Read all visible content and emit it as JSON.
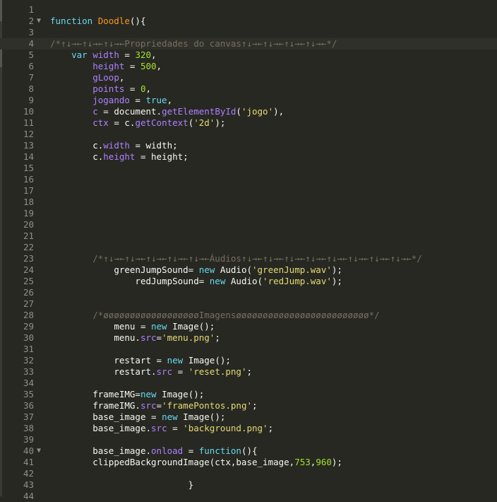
{
  "editor": {
    "lines": [
      {
        "n": "1",
        "fold": "",
        "indent": "",
        "tokens": []
      },
      {
        "n": "2",
        "fold": "▼",
        "indent": "",
        "tokens": [
          {
            "t": "kw",
            "v": "function "
          },
          {
            "t": "fn",
            "v": "Doodle"
          },
          {
            "t": "plain",
            "v": "(){"
          }
        ]
      },
      {
        "n": "3",
        "fold": "",
        "indent": "",
        "tokens": []
      },
      {
        "n": "4",
        "fold": "",
        "indent": "",
        "tokens": [
          {
            "t": "cmt",
            "v": "/*↑↓→←↑↓→←↑↓→←Propriedades do canvas↑↓→←↑↓→←↑↓→←↑↓→←*/"
          }
        ]
      },
      {
        "n": "5",
        "fold": "",
        "indent": "    ",
        "tokens": [
          {
            "t": "kw",
            "v": "var "
          },
          {
            "t": "var",
            "v": "width"
          },
          {
            "t": "plain",
            "v": " = "
          },
          {
            "t": "num",
            "v": "320"
          },
          {
            "t": "plain",
            "v": ","
          }
        ]
      },
      {
        "n": "6",
        "fold": "",
        "indent": "        ",
        "tokens": [
          {
            "t": "var",
            "v": "height"
          },
          {
            "t": "plain",
            "v": " = "
          },
          {
            "t": "num",
            "v": "500"
          },
          {
            "t": "plain",
            "v": ","
          }
        ]
      },
      {
        "n": "7",
        "fold": "",
        "indent": "        ",
        "tokens": [
          {
            "t": "var",
            "v": "gLoop"
          },
          {
            "t": "plain",
            "v": ","
          }
        ]
      },
      {
        "n": "8",
        "fold": "",
        "indent": "        ",
        "tokens": [
          {
            "t": "var",
            "v": "points"
          },
          {
            "t": "plain",
            "v": " = "
          },
          {
            "t": "num",
            "v": "0"
          },
          {
            "t": "plain",
            "v": ","
          }
        ]
      },
      {
        "n": "9",
        "fold": "",
        "indent": "        ",
        "tokens": [
          {
            "t": "var",
            "v": "jogando"
          },
          {
            "t": "plain",
            "v": " = "
          },
          {
            "t": "kw",
            "v": "true"
          },
          {
            "t": "plain",
            "v": ","
          }
        ]
      },
      {
        "n": "10",
        "fold": "",
        "indent": "        ",
        "tokens": [
          {
            "t": "var",
            "v": "c"
          },
          {
            "t": "plain",
            "v": " = document."
          },
          {
            "t": "var",
            "v": "getElementById"
          },
          {
            "t": "plain",
            "v": "("
          },
          {
            "t": "str",
            "v": "'jogo'"
          },
          {
            "t": "plain",
            "v": "),"
          }
        ]
      },
      {
        "n": "11",
        "fold": "",
        "indent": "        ",
        "tokens": [
          {
            "t": "var",
            "v": "ctx"
          },
          {
            "t": "plain",
            "v": " = c."
          },
          {
            "t": "var",
            "v": "getContext"
          },
          {
            "t": "plain",
            "v": "("
          },
          {
            "t": "str",
            "v": "'2d'"
          },
          {
            "t": "plain",
            "v": ");"
          }
        ]
      },
      {
        "n": "12",
        "fold": "",
        "indent": "",
        "tokens": []
      },
      {
        "n": "13",
        "fold": "",
        "indent": "        ",
        "tokens": [
          {
            "t": "plain",
            "v": "c."
          },
          {
            "t": "var",
            "v": "width"
          },
          {
            "t": "plain",
            "v": " = width;"
          }
        ]
      },
      {
        "n": "14",
        "fold": "",
        "indent": "        ",
        "tokens": [
          {
            "t": "plain",
            "v": "c."
          },
          {
            "t": "var",
            "v": "height"
          },
          {
            "t": "plain",
            "v": " = height;"
          }
        ]
      },
      {
        "n": "15",
        "fold": "",
        "indent": "",
        "tokens": []
      },
      {
        "n": "16",
        "fold": "",
        "indent": "",
        "tokens": []
      },
      {
        "n": "17",
        "fold": "",
        "indent": "",
        "tokens": []
      },
      {
        "n": "18",
        "fold": "",
        "indent": "",
        "tokens": []
      },
      {
        "n": "19",
        "fold": "",
        "indent": "",
        "tokens": []
      },
      {
        "n": "20",
        "fold": "",
        "indent": "",
        "tokens": []
      },
      {
        "n": "21",
        "fold": "",
        "indent": "",
        "tokens": []
      },
      {
        "n": "22",
        "fold": "",
        "indent": "",
        "tokens": []
      },
      {
        "n": "23",
        "fold": "",
        "indent": "        ",
        "tokens": [
          {
            "t": "cmt",
            "v": "/*↑↓→←↑↓→←↑↓→←↑↓→←↑↓→←Áudios↑↓→←↑↓→←↑↓→←↑↓→←↑↓→←↑↓→←↑↓→←↑↓→←*/"
          }
        ]
      },
      {
        "n": "24",
        "fold": "",
        "indent": "            ",
        "tokens": [
          {
            "t": "plain",
            "v": "greenJumpSound= "
          },
          {
            "t": "kw",
            "v": "new "
          },
          {
            "t": "plain",
            "v": "Audio("
          },
          {
            "t": "str",
            "v": "'greenJump.wav'"
          },
          {
            "t": "plain",
            "v": ");"
          }
        ]
      },
      {
        "n": "25",
        "fold": "",
        "indent": "                ",
        "tokens": [
          {
            "t": "plain",
            "v": "redJumpSound= "
          },
          {
            "t": "kw",
            "v": "new "
          },
          {
            "t": "plain",
            "v": "Audio("
          },
          {
            "t": "str",
            "v": "'redJump.wav'"
          },
          {
            "t": "plain",
            "v": ");"
          }
        ]
      },
      {
        "n": "26",
        "fold": "",
        "indent": "",
        "tokens": []
      },
      {
        "n": "27",
        "fold": "",
        "indent": "",
        "tokens": []
      },
      {
        "n": "28",
        "fold": "",
        "indent": "        ",
        "tokens": [
          {
            "t": "cmt",
            "v": "/*øøøøøøøøøøøøøøøøøøImagensøøøøøøøøøøøøøøøøøøøøøøøøø*/"
          }
        ]
      },
      {
        "n": "29",
        "fold": "",
        "indent": "            ",
        "tokens": [
          {
            "t": "plain",
            "v": "menu = "
          },
          {
            "t": "kw",
            "v": "new "
          },
          {
            "t": "plain",
            "v": "Image();"
          }
        ]
      },
      {
        "n": "30",
        "fold": "",
        "indent": "            ",
        "tokens": [
          {
            "t": "plain",
            "v": "menu."
          },
          {
            "t": "var",
            "v": "src"
          },
          {
            "t": "plain",
            "v": "="
          },
          {
            "t": "str",
            "v": "'menu.png'"
          },
          {
            "t": "plain",
            "v": ";"
          }
        ]
      },
      {
        "n": "31",
        "fold": "",
        "indent": "",
        "tokens": []
      },
      {
        "n": "32",
        "fold": "",
        "indent": "            ",
        "tokens": [
          {
            "t": "plain",
            "v": "restart = "
          },
          {
            "t": "kw",
            "v": "new "
          },
          {
            "t": "plain",
            "v": "Image();"
          }
        ]
      },
      {
        "n": "33",
        "fold": "",
        "indent": "            ",
        "tokens": [
          {
            "t": "plain",
            "v": "restart."
          },
          {
            "t": "var",
            "v": "src"
          },
          {
            "t": "plain",
            "v": " = "
          },
          {
            "t": "str",
            "v": "'reset.png'"
          },
          {
            "t": "plain",
            "v": ";"
          }
        ]
      },
      {
        "n": "34",
        "fold": "",
        "indent": "",
        "tokens": []
      },
      {
        "n": "35",
        "fold": "",
        "indent": "        ",
        "tokens": [
          {
            "t": "plain",
            "v": "frameIMG="
          },
          {
            "t": "kw",
            "v": "new "
          },
          {
            "t": "plain",
            "v": "Image();"
          }
        ]
      },
      {
        "n": "36",
        "fold": "",
        "indent": "        ",
        "tokens": [
          {
            "t": "plain",
            "v": "frameIMG."
          },
          {
            "t": "var",
            "v": "src"
          },
          {
            "t": "plain",
            "v": "="
          },
          {
            "t": "str",
            "v": "'framePontos.png'"
          },
          {
            "t": "plain",
            "v": ";"
          }
        ]
      },
      {
        "n": "37",
        "fold": "",
        "indent": "        ",
        "tokens": [
          {
            "t": "plain",
            "v": "base_image = "
          },
          {
            "t": "kw",
            "v": "new "
          },
          {
            "t": "plain",
            "v": "Image();"
          }
        ]
      },
      {
        "n": "38",
        "fold": "",
        "indent": "        ",
        "tokens": [
          {
            "t": "plain",
            "v": "base_image."
          },
          {
            "t": "var",
            "v": "src"
          },
          {
            "t": "plain",
            "v": " = "
          },
          {
            "t": "str",
            "v": "'background.png'"
          },
          {
            "t": "plain",
            "v": ";"
          }
        ]
      },
      {
        "n": "39",
        "fold": "",
        "indent": "",
        "tokens": []
      },
      {
        "n": "40",
        "fold": "▼",
        "indent": "        ",
        "tokens": [
          {
            "t": "plain",
            "v": "base_image."
          },
          {
            "t": "var",
            "v": "onload"
          },
          {
            "t": "plain",
            "v": " = "
          },
          {
            "t": "kw",
            "v": "function"
          },
          {
            "t": "plain",
            "v": "(){"
          }
        ]
      },
      {
        "n": "41",
        "fold": "",
        "indent": "        ",
        "tokens": [
          {
            "t": "plain",
            "v": "clippedBackgroundImage(ctx,base_image,"
          },
          {
            "t": "num",
            "v": "753"
          },
          {
            "t": "plain",
            "v": ","
          },
          {
            "t": "num",
            "v": "960"
          },
          {
            "t": "plain",
            "v": ");"
          }
        ]
      },
      {
        "n": "42",
        "fold": "",
        "indent": "",
        "tokens": []
      },
      {
        "n": "43",
        "fold": "",
        "indent": "                          ",
        "tokens": [
          {
            "t": "plain",
            "v": "}"
          }
        ]
      },
      {
        "n": "44",
        "fold": "",
        "indent": "",
        "tokens": []
      }
    ]
  },
  "colors": {
    "background": "#272822",
    "keyword": "#66d9ef",
    "function_name": "#fd971f",
    "property": "#ae81ff",
    "number": "#a6e22e",
    "string": "#e6db74",
    "comment": "#75715e",
    "text": "#f8f8f2",
    "gutter": "#8f908a"
  }
}
